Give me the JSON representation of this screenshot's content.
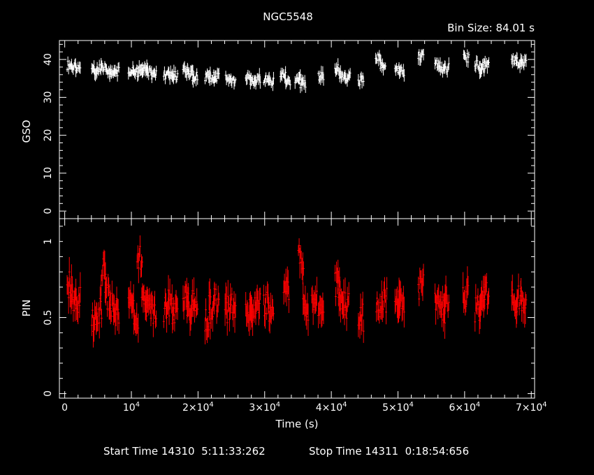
{
  "chart_data": [
    {
      "type": "scatter",
      "title": "NGC5548",
      "subtitle": "Bin Size: 84.01 s",
      "ylabel": "GSO",
      "xlabel": "",
      "xlim": [
        -800,
        70500
      ],
      "ylim": [
        -2,
        45
      ],
      "yticks": [
        0,
        10,
        20,
        30,
        40
      ],
      "color": "#ffffff",
      "series": [
        {
          "x": [
            800,
            1400,
            2000,
            4500,
            5200,
            5900,
            6600,
            7200,
            7800,
            10000,
            10700,
            11400,
            12100,
            12700,
            13400,
            15300,
            16000,
            16600,
            18200,
            18900,
            19600,
            21500,
            22200,
            22800,
            24600,
            25300,
            27600,
            28300,
            29000,
            30300,
            31000,
            32800,
            33500,
            35000,
            35800,
            38500,
            41000,
            41700,
            42500,
            44500,
            47100,
            47800,
            50000,
            50600,
            53500,
            56000,
            56700,
            57300,
            60300,
            62000,
            62700,
            63300,
            67500,
            68200,
            68900
          ],
          "y": [
            38.5,
            38,
            38.2,
            37,
            37.5,
            37.8,
            37,
            36.5,
            36.8,
            37,
            36.5,
            37.2,
            37.5,
            36.8,
            36,
            36,
            35.5,
            35.8,
            37,
            36.2,
            35.5,
            35.5,
            35,
            35.5,
            35,
            34.8,
            35,
            34.5,
            35,
            35,
            34.2,
            36,
            34.5,
            35,
            33.5,
            35.5,
            37.5,
            36,
            35.5,
            34.5,
            40.5,
            38,
            37.2,
            36.8,
            41,
            38.5,
            37.5,
            37.8,
            40.5,
            38.8,
            37.5,
            38.5,
            39.5,
            39.3,
            39
          ]
        }
      ]
    },
    {
      "type": "scatter",
      "title": "",
      "xlabel": "Time (s)",
      "ylabel": "PIN",
      "xlim": [
        -800,
        70500
      ],
      "ylim": [
        -0.03,
        1.15
      ],
      "yticks": [
        0,
        0.5,
        1
      ],
      "yticklabels": [
        "0",
        "0.5",
        "1"
      ],
      "xticklabels": [
        "0",
        "10⁴",
        "2×10⁴",
        "3×10⁴",
        "4×10⁴",
        "5×10⁴",
        "6×10⁴",
        "7×10⁴"
      ],
      "xtickvalues": [
        0,
        10000,
        20000,
        30000,
        40000,
        50000,
        60000,
        70000
      ],
      "color": "#ff0000",
      "series": [
        {
          "x": [
            800,
            1400,
            2000,
            4500,
            5200,
            5900,
            6500,
            7100,
            7800,
            10000,
            10700,
            11300,
            12000,
            12600,
            13400,
            15300,
            16000,
            16600,
            18200,
            18800,
            19600,
            21500,
            22100,
            22800,
            24500,
            25300,
            27600,
            28200,
            29000,
            30300,
            31000,
            33300,
            35500,
            36200,
            37500,
            38500,
            41000,
            41500,
            42300,
            44500,
            47200,
            48000,
            50000,
            50600,
            53500,
            56000,
            56700,
            57300,
            60200,
            62000,
            62700,
            63300,
            67500,
            68200,
            68900
          ],
          "y": [
            0.72,
            0.6,
            0.62,
            0.47,
            0.55,
            0.8,
            0.63,
            0.58,
            0.55,
            0.6,
            0.52,
            0.9,
            0.6,
            0.57,
            0.55,
            0.55,
            0.6,
            0.55,
            0.62,
            0.55,
            0.6,
            0.5,
            0.58,
            0.6,
            0.55,
            0.58,
            0.55,
            0.56,
            0.6,
            0.58,
            0.55,
            0.68,
            0.9,
            0.55,
            0.6,
            0.55,
            0.72,
            0.62,
            0.58,
            0.5,
            0.55,
            0.62,
            0.58,
            0.6,
            0.7,
            0.62,
            0.55,
            0.6,
            0.65,
            0.55,
            0.6,
            0.65,
            0.62,
            0.62,
            0.6
          ]
        }
      ]
    }
  ],
  "footer": {
    "start_label": "Start Time 14310  5:11:33:262",
    "stop_label": "Stop Time 14311  0:18:54:656"
  }
}
